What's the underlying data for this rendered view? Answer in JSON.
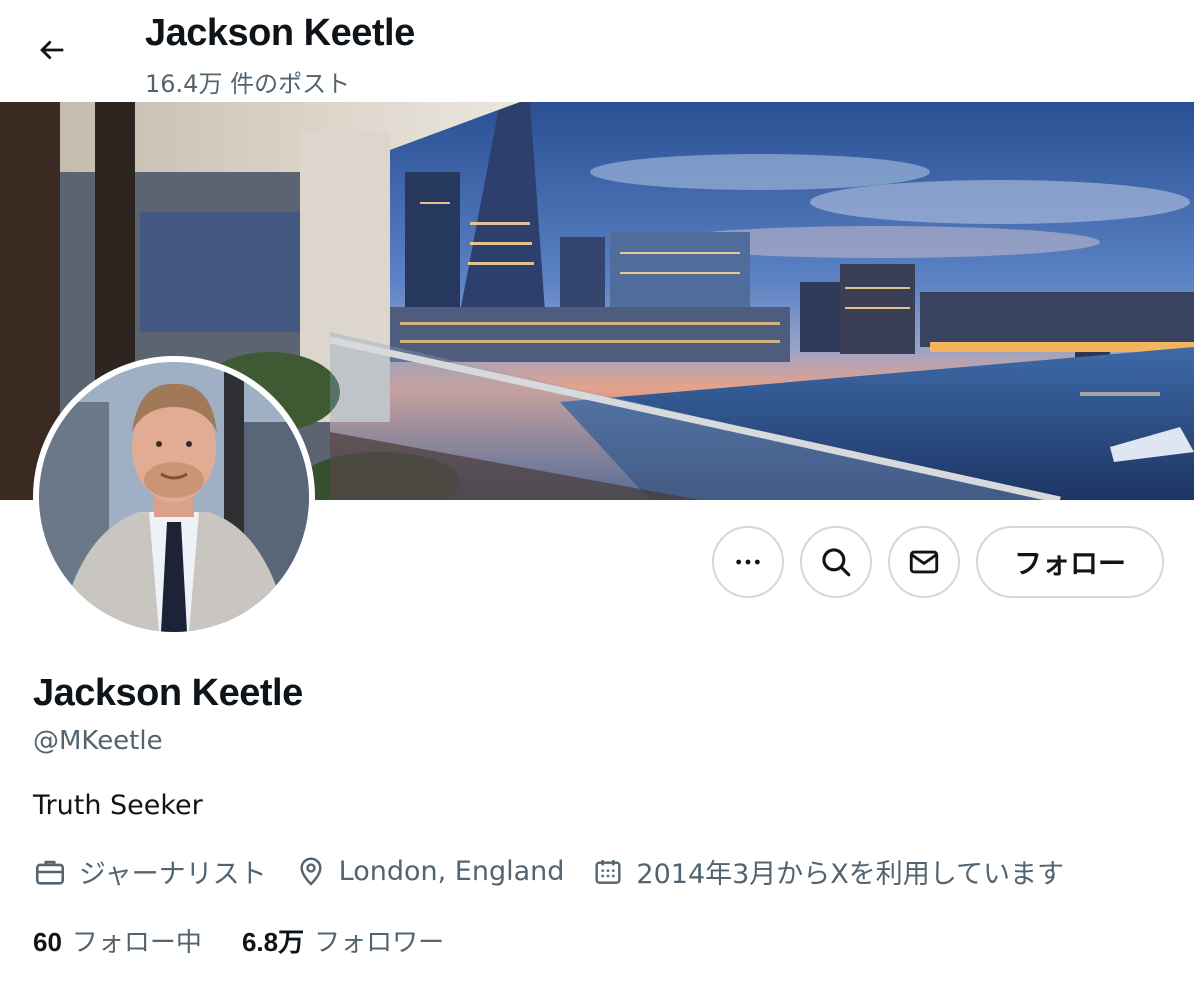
{
  "header": {
    "title": "Jackson Keetle",
    "post_count": "16.4万 件のポスト"
  },
  "actions": {
    "more_label": "…",
    "follow_label": "フォロー"
  },
  "profile": {
    "name": "Jackson Keetle",
    "handle": "@MKeetle",
    "bio": "Truth Seeker",
    "profession": "ジャーナリスト",
    "location": "London, England",
    "joined": "2014年3月からXを利用しています"
  },
  "stats": {
    "following_count": "60",
    "following_label": "フォロー中",
    "followers_count": "6.8万",
    "followers_label": "フォロワー"
  },
  "icons": [
    "back-arrow-icon",
    "more-icon",
    "search-icon",
    "mail-icon",
    "briefcase-icon",
    "location-pin-icon",
    "calendar-icon"
  ],
  "colors": {
    "text_primary": "#0f1419",
    "text_secondary": "#536471",
    "border": "#cfd9de"
  }
}
